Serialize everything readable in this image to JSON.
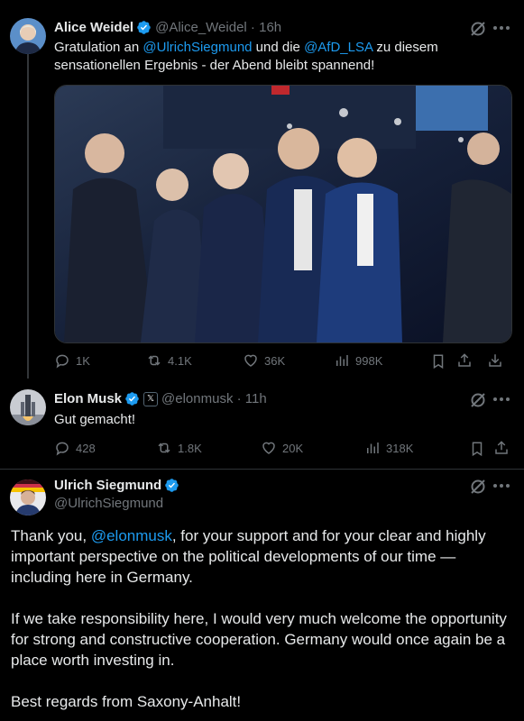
{
  "tweet1": {
    "name": "Alice Weidel",
    "handle": "@Alice_Weidel",
    "time": "16h",
    "text_pre": "Gratulation an ",
    "mention1": "@UlrichSiegmund",
    "text_mid": " und die ",
    "mention2": "@AfD_LSA",
    "text_post": " zu diesem sensationellen Ergebnis - der Abend bleibt spannend!",
    "replies": "1K",
    "reposts": "4.1K",
    "likes": "36K",
    "views": "998K"
  },
  "tweet2": {
    "name": "Elon Musk",
    "handle": "@elonmusk",
    "time": "11h",
    "text": "Gut gemacht!",
    "replies": "428",
    "reposts": "1.8K",
    "likes": "20K",
    "views": "318K"
  },
  "tweet3": {
    "name": "Ulrich Siegmund",
    "handle": "@UlrichSiegmund",
    "p1_pre": "Thank you, ",
    "p1_mention": "@elonmusk",
    "p1_post": ", for your support and for your clear and highly important perspective on the political developments of our time — including here in Germany.",
    "p2": "If we take responsibility here, I would very much welcome the opportunity for strong and constructive cooperation. Germany would once again be a place worth investing in.",
    "p3": "Best regards from Saxony-Anhalt!"
  },
  "colors": {
    "background": "#000000",
    "text": "#e7e9ea",
    "secondary": "#71767b",
    "accent": "#1d9bf0",
    "separator": "#2f3336"
  },
  "icons": [
    "verified-badge-icon",
    "grok-icon",
    "more-icon",
    "reply-icon",
    "repost-icon",
    "like-icon",
    "views-icon",
    "bookmark-icon",
    "share-icon",
    "download-icon",
    "x-affiliation-icon"
  ]
}
